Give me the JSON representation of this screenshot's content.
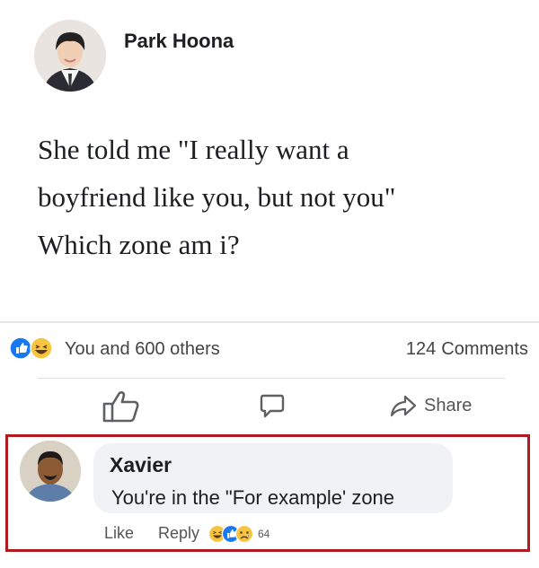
{
  "post": {
    "author": "Park Hoona",
    "text_lines": [
      "She told me \"I really want a",
      "boyfriend like you, but not you\"",
      "Which zone am i?"
    ],
    "reactions_text": "You and 600 others",
    "comments_count": "124",
    "comments_label": "Comments",
    "reaction_icons": [
      "like-icon",
      "haha-icon"
    ]
  },
  "actions": {
    "like_icon": "thumbs-up-icon",
    "comment_icon": "comment-bubble-icon",
    "share_label": "Share"
  },
  "comment": {
    "author": "Xavier",
    "text": "You're in the \"For example' zone",
    "like_label": "Like",
    "reply_label": "Reply",
    "reaction_icons": [
      "haha-icon",
      "like-icon",
      "sad-icon"
    ],
    "reaction_count": "64"
  },
  "colors": {
    "highlight_border": "#b21a22",
    "like_blue": "#1877f2",
    "haha_yellow": "#f7c440"
  }
}
